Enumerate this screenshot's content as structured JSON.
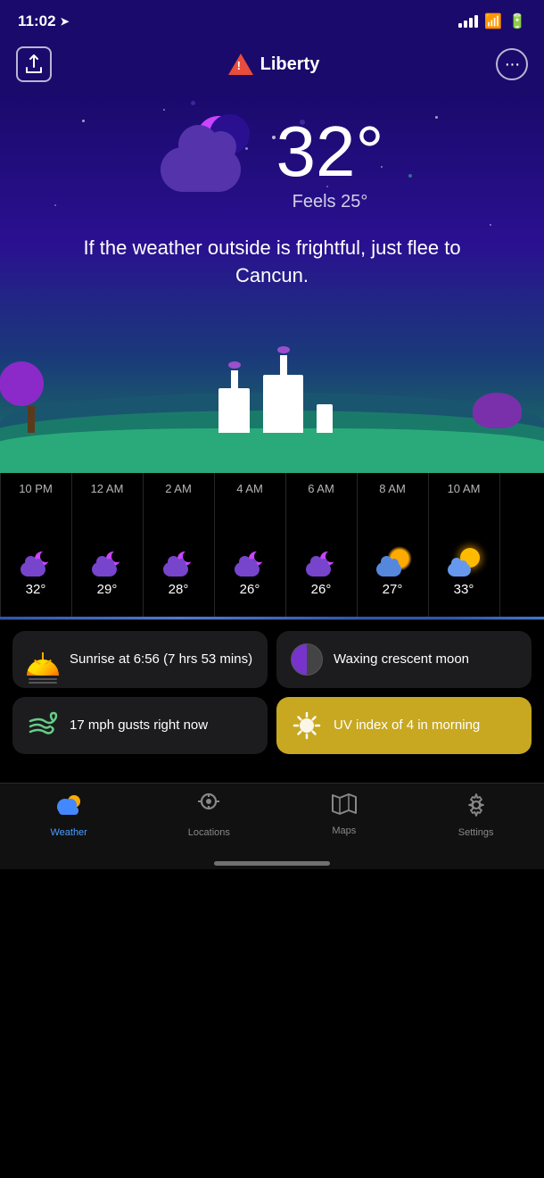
{
  "statusBar": {
    "time": "11:02",
    "hasLocation": true
  },
  "header": {
    "city": "Liberty",
    "hasAlert": true,
    "shareLabel": "⬆",
    "moreLabel": "···"
  },
  "weather": {
    "temperature": "32°",
    "feelsLike": "Feels 25°",
    "tagline": "If the weather outside is frightful, just flee to Cancun."
  },
  "hourly": [
    {
      "time": "10 PM",
      "temp": "32°",
      "icon": "cloudy-night",
      "offsetY": 0
    },
    {
      "time": "12 AM",
      "temp": "29°",
      "icon": "cloudy-night",
      "offsetY": 15
    },
    {
      "time": "2 AM",
      "temp": "28°",
      "icon": "cloudy-night",
      "offsetY": 20
    },
    {
      "time": "4 AM",
      "temp": "26°",
      "icon": "cloudy-night",
      "offsetY": 30
    },
    {
      "time": "6 AM",
      "temp": "26°",
      "icon": "cloudy-night",
      "offsetY": 30
    },
    {
      "time": "8 AM",
      "temp": "27°",
      "icon": "partly-cloudy-day",
      "offsetY": 25
    },
    {
      "time": "10 AM",
      "temp": "33°",
      "icon": "partly-cloudy-sun",
      "offsetY": 0
    }
  ],
  "infoCards": [
    {
      "id": "sunrise",
      "icon": "🌅",
      "text": "Sunrise at 6:56 (7 hrs 53 mins)",
      "yellow": false
    },
    {
      "id": "moon",
      "icon": "🌗",
      "text": "Waxing crescent moon",
      "yellow": false
    },
    {
      "id": "wind",
      "icon": "💨",
      "text": "17 mph gusts right now",
      "yellow": false
    },
    {
      "id": "uv",
      "icon": "☀",
      "text": "UV index of 4 in morning",
      "yellow": true
    }
  ],
  "bottomNav": [
    {
      "id": "weather",
      "label": "Weather",
      "icon": "🌤",
      "active": true
    },
    {
      "id": "locations",
      "label": "Locations",
      "icon": "🔍",
      "active": false
    },
    {
      "id": "maps",
      "label": "Maps",
      "icon": "🗺",
      "active": false
    },
    {
      "id": "settings",
      "label": "Settings",
      "icon": "⚙",
      "active": false
    }
  ]
}
